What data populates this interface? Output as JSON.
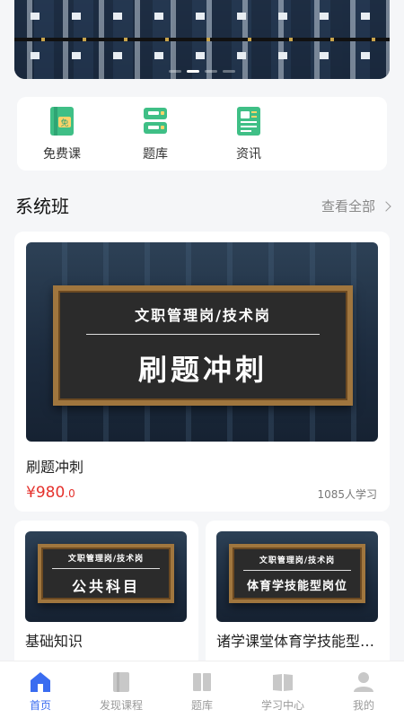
{
  "banner": {
    "dots": 4,
    "active_dot": 1
  },
  "quick_menu": [
    {
      "label": "免费课",
      "icon": "free-course-icon",
      "badge": "免"
    },
    {
      "label": "题库",
      "icon": "question-bank-icon"
    },
    {
      "label": "资讯",
      "icon": "news-icon"
    }
  ],
  "section": {
    "title": "系统班",
    "more": "查看全部"
  },
  "featured_course": {
    "cover_subtitle": "文职管理岗/技术岗",
    "cover_title": "刷题冲刺",
    "name": "刷题冲刺",
    "price": "¥980",
    "price_decimal": ".0",
    "learners": "1085人学习"
  },
  "courses": [
    {
      "cover_subtitle": "文职管理岗/技术岗",
      "cover_title": "公共科目",
      "name": "基础知识"
    },
    {
      "cover_subtitle": "文职管理岗/技术岗",
      "cover_title": "体育学技能型岗位",
      "name": "诸学课堂体育学技能型岗位"
    }
  ],
  "tabbar": [
    {
      "label": "首页",
      "icon": "home-icon",
      "active": true
    },
    {
      "label": "发现课程",
      "icon": "discover-icon"
    },
    {
      "label": "题库",
      "icon": "question-bank-tab-icon"
    },
    {
      "label": "学习中心",
      "icon": "study-center-icon"
    },
    {
      "label": "我的",
      "icon": "profile-icon"
    }
  ],
  "colors": {
    "accent": "#3a6cf0",
    "price": "#e5322d",
    "icon_green": "#3fbf86"
  }
}
